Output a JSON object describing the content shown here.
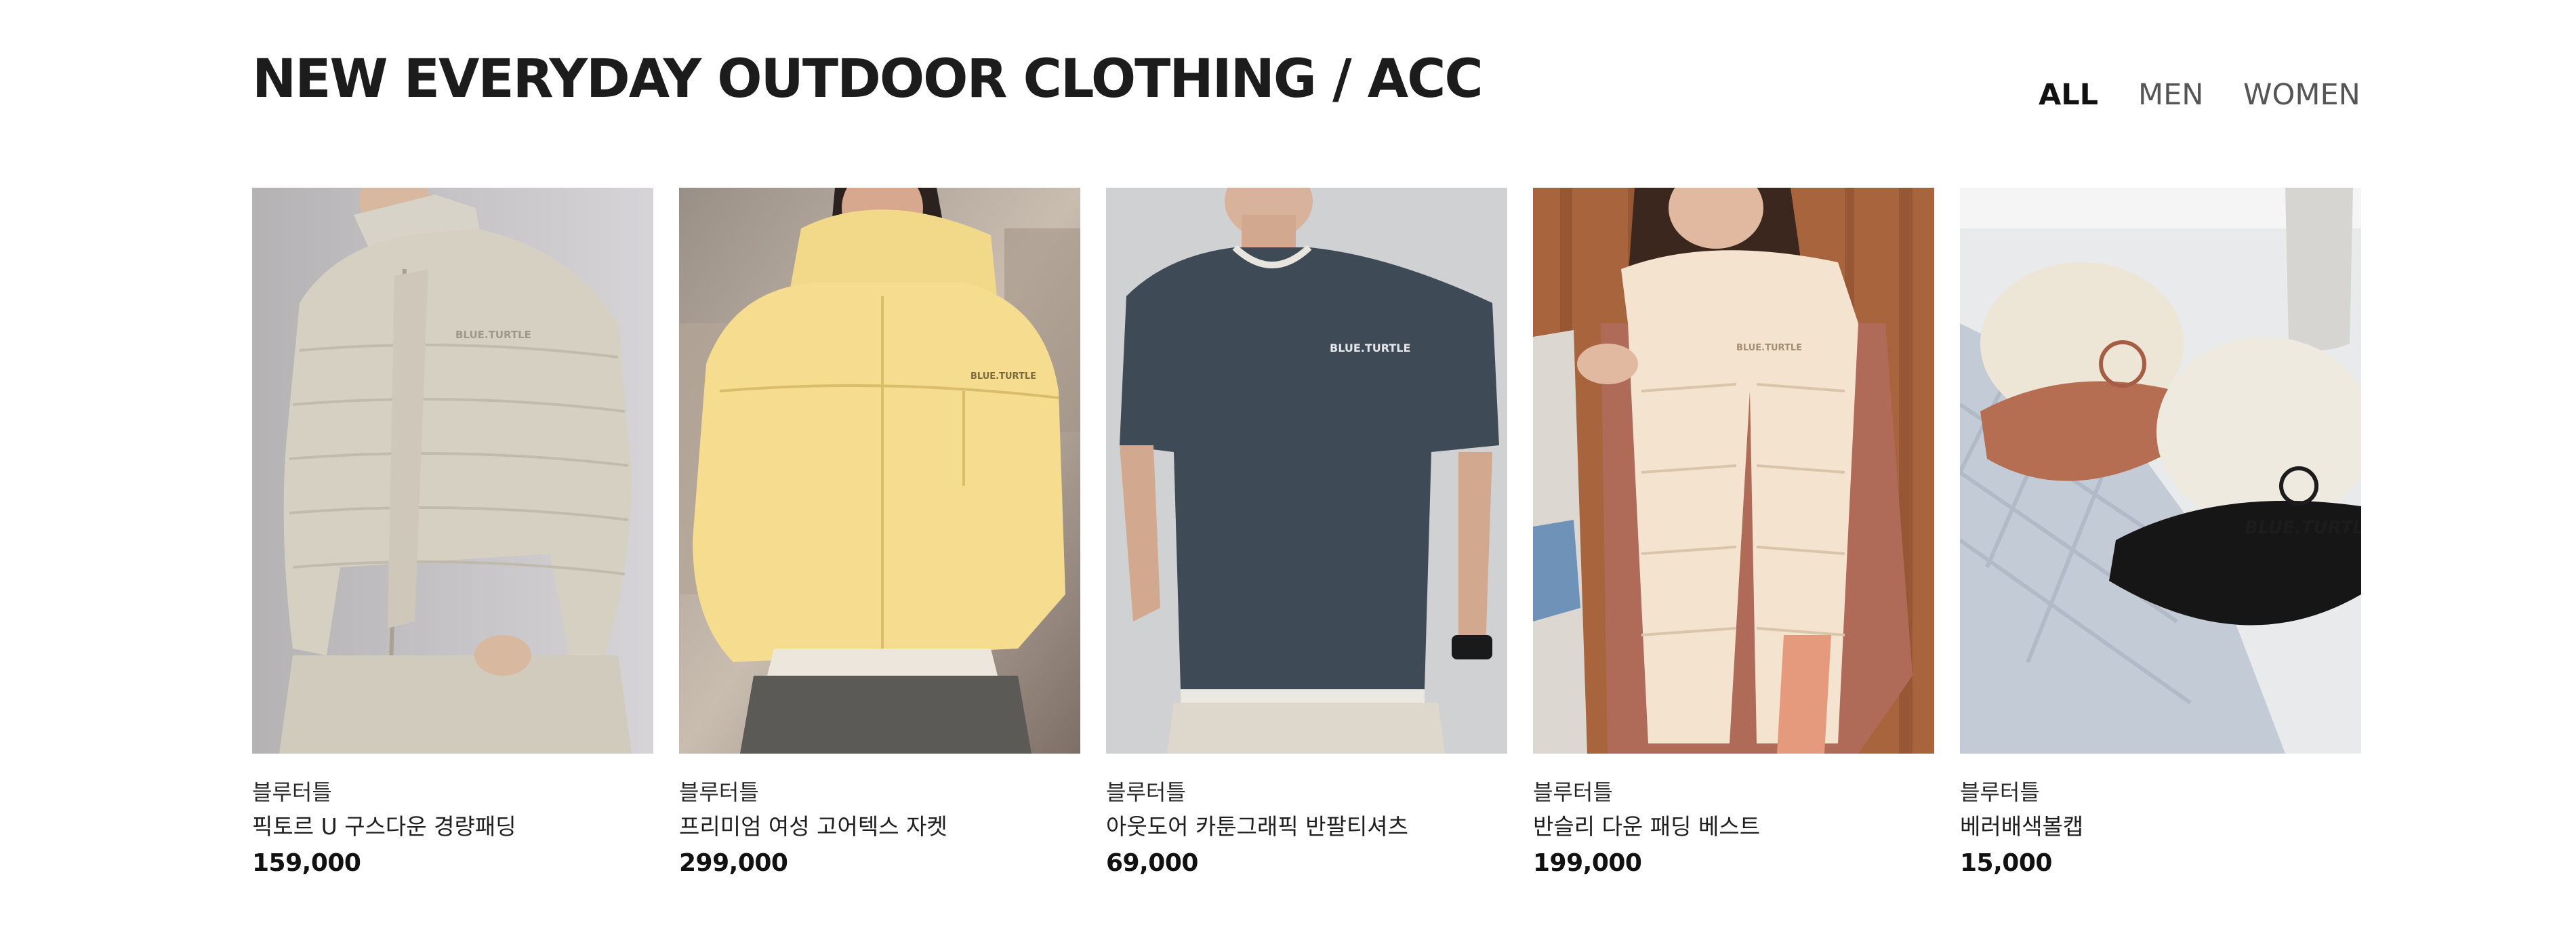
{
  "section": {
    "title": "NEW EVERYDAY OUTDOOR CLOTHING / ACC"
  },
  "filters": [
    {
      "label": "ALL",
      "active": true
    },
    {
      "label": "MEN",
      "active": false
    },
    {
      "label": "WOMEN",
      "active": false
    }
  ],
  "products": [
    {
      "brand": "블루터틀",
      "name": "픽토르 U 구스다운 경량패딩",
      "price": "159,000",
      "image": "beige puffer jacket on male model"
    },
    {
      "brand": "블루터틀",
      "name": "프리미엄 여성 고어텍스 자켓",
      "price": "299,000",
      "image": "yellow hooded windbreaker on female model"
    },
    {
      "brand": "블루터틀",
      "name": "아웃도어 카툰그래픽 반팔티셔츠",
      "price": "69,000",
      "image": "navy short-sleeve t-shirt on male model"
    },
    {
      "brand": "블루터틀",
      "name": "반슬리 다운 패딩 베스트",
      "price": "199,000",
      "image": "cream padded down vest on female model"
    },
    {
      "brand": "블루터틀",
      "name": "베러배색볼캡",
      "price": "15,000",
      "image": "two color-block ball caps on table"
    }
  ],
  "logo_text": "BLUE.TURTLE"
}
